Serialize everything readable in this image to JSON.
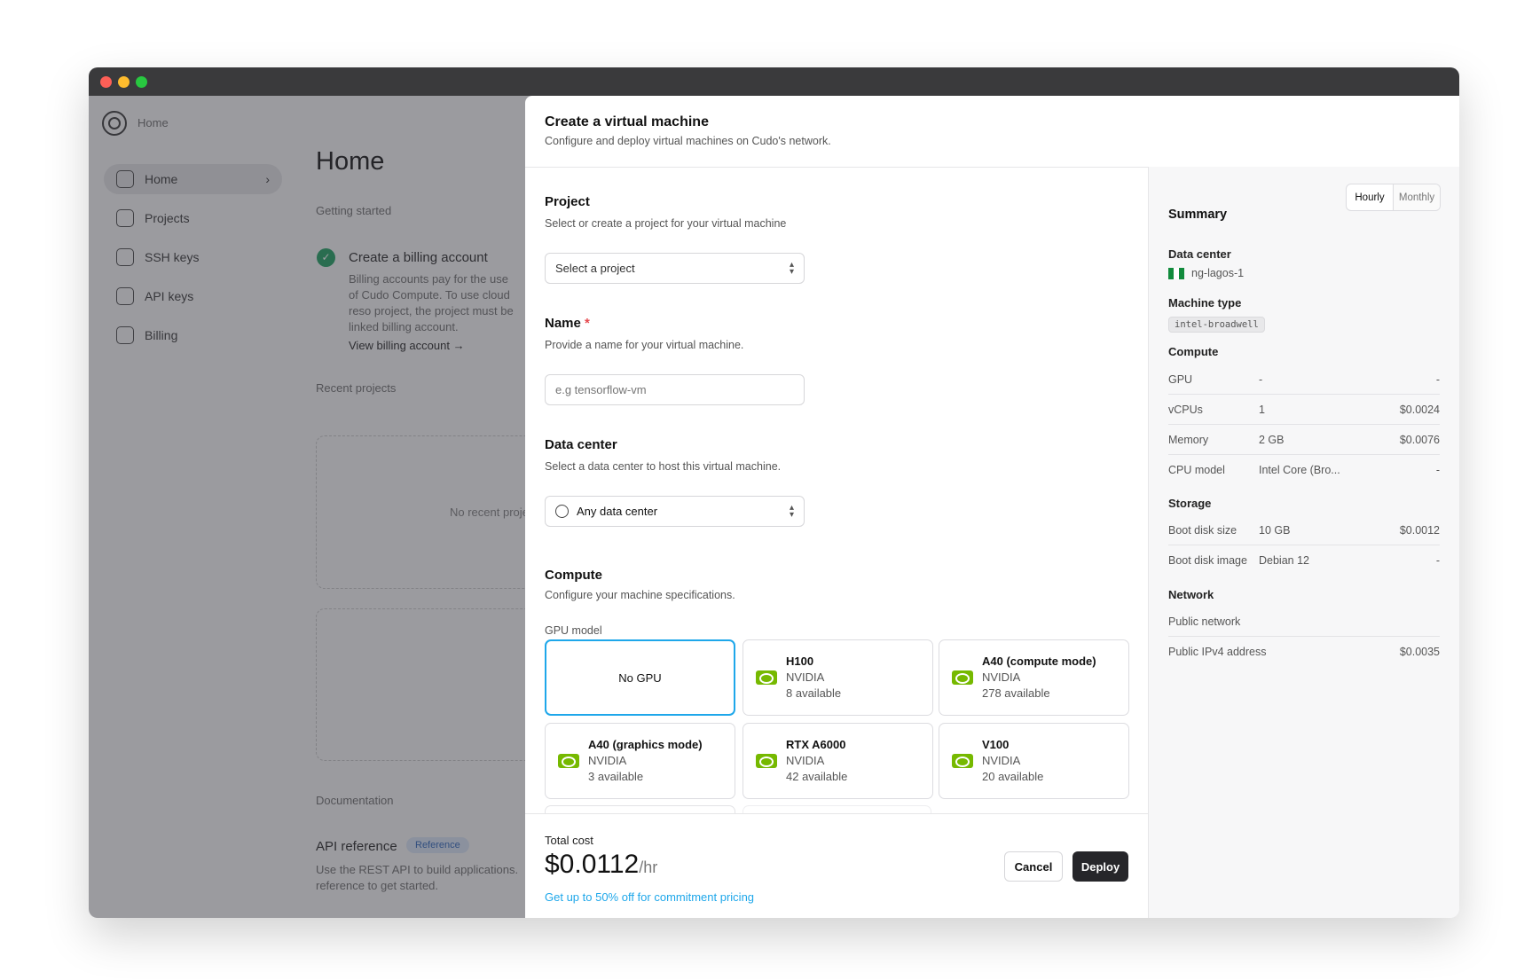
{
  "window": {
    "controls": [
      "close",
      "minimize",
      "maximize"
    ],
    "colors": {
      "close": "#fe5f57",
      "minimize": "#febc2e",
      "maximize": "#28c840"
    }
  },
  "background": {
    "breadcrumb": "Home",
    "sidebar": [
      {
        "label": "Home",
        "icon": "home-icon",
        "active": true
      },
      {
        "label": "Projects",
        "icon": "folder-icon"
      },
      {
        "label": "SSH keys",
        "icon": "terminal-icon"
      },
      {
        "label": "API keys",
        "icon": "key-icon"
      },
      {
        "label": "Billing",
        "icon": "card-icon"
      }
    ],
    "page_title": "Home",
    "getting_started": "Getting started",
    "billing_title": "Create a billing account",
    "billing_text": "Billing accounts pay for the use of Cudo Compute. To use cloud reso project, the project must be linked billing account.",
    "billing_link": "View billing account",
    "recent_projects": "Recent projects",
    "no_recent": "No recent proje",
    "documentation": "Documentation",
    "api_reference": "API reference",
    "reference_badge": "Reference",
    "api_text": "Use the REST API to build applications. reference to get started."
  },
  "modal": {
    "title": "Create a virtual machine",
    "subtitle": "Configure and deploy virtual machines on Cudo's network.",
    "project": {
      "label": "Project",
      "help": "Select or create a project for your virtual machine",
      "placeholder": "Select a project"
    },
    "name": {
      "label": "Name",
      "required": "*",
      "help": "Provide a name for your virtual machine.",
      "placeholder": "e.g tensorflow-vm"
    },
    "data_center": {
      "label": "Data center",
      "help": "Select a data center to host this virtual machine.",
      "value": "Any data center"
    },
    "compute": {
      "label": "Compute",
      "help": "Configure your machine specifications.",
      "gpu_label": "GPU model",
      "gpus": [
        {
          "name": "No GPU",
          "selected": true
        },
        {
          "name": "H100",
          "vendor": "NVIDIA",
          "available": "8 available"
        },
        {
          "name": "A40 (compute mode)",
          "vendor": "NVIDIA",
          "available": "278 available"
        },
        {
          "name": "A40 (graphics mode)",
          "vendor": "NVIDIA",
          "available": "3 available"
        },
        {
          "name": "RTX A6000",
          "vendor": "NVIDIA",
          "available": "42 available"
        },
        {
          "name": "V100",
          "vendor": "NVIDIA",
          "available": "20 available"
        }
      ]
    },
    "footer": {
      "total_label": "Total cost",
      "total": "$0.0112",
      "unit": "/hr",
      "promo": "Get up to 50% off for commitment pricing",
      "cancel": "Cancel",
      "deploy": "Deploy"
    },
    "summary": {
      "title": "Summary",
      "toggle": [
        "Hourly",
        "Monthly"
      ],
      "toggle_selected": "Hourly",
      "data_center_label": "Data center",
      "data_center": "ng-lagos-1",
      "machine_type_label": "Machine type",
      "machine_type": "intel-broadwell",
      "compute_label": "Compute",
      "compute_rows": [
        {
          "label": "GPU",
          "value": "-",
          "price": "-"
        },
        {
          "label": "vCPUs",
          "value": "1",
          "price": "$0.0024"
        },
        {
          "label": "Memory",
          "value": "2 GB",
          "price": "$0.0076"
        },
        {
          "label": "CPU model",
          "value": "Intel Core (Bro...",
          "price": "-"
        }
      ],
      "storage_label": "Storage",
      "storage_rows": [
        {
          "label": "Boot disk size",
          "value": "10 GB",
          "price": "$0.0012"
        },
        {
          "label": "Boot disk image",
          "value": "Debian 12",
          "price": "-"
        }
      ],
      "network_label": "Network",
      "network_rows": [
        {
          "label": "Public network",
          "value": "",
          "price": ""
        },
        {
          "label": "Public IPv4 address",
          "value": "",
          "price": "$0.0035"
        }
      ]
    },
    "accent": "#1ea7ea",
    "nvidia_green": "#76b900"
  }
}
